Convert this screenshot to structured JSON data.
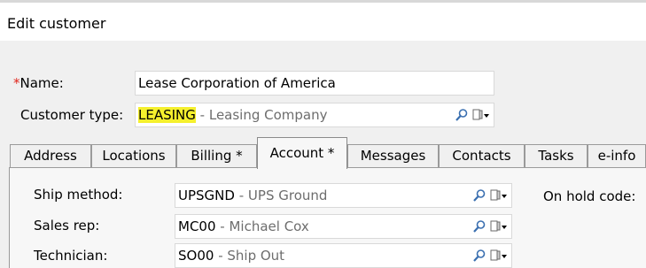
{
  "window": {
    "title": "Edit customer"
  },
  "form": {
    "name_required_mark": "*",
    "name_label": "Name:",
    "name_value": "Lease Corporation of America",
    "customer_type_label": "Customer type:",
    "customer_type_code": "LEASING",
    "customer_type_desc": "- Leasing Company"
  },
  "tabs": [
    {
      "label": "Address"
    },
    {
      "label": "Locations"
    },
    {
      "label": "Billing *"
    },
    {
      "label": "Account *"
    },
    {
      "label": "Messages"
    },
    {
      "label": "Contacts"
    },
    {
      "label": "Tasks"
    },
    {
      "label": "e-info"
    }
  ],
  "active_tab": "Account *",
  "account": {
    "ship_method_label": "Ship method:",
    "ship_method_code": "UPSGND",
    "ship_method_desc": "- UPS Ground",
    "sales_rep_label": "Sales rep:",
    "sales_rep_code": "MC00",
    "sales_rep_desc": "- Michael Cox",
    "technician_label": "Technician:",
    "technician_code": "SO00",
    "technician_desc": "- Ship Out",
    "on_hold_label": "On hold code:"
  },
  "icons": {
    "lookup": "magnifier-icon",
    "menu": "document-dropdown-icon"
  },
  "colors": {
    "required": "#e0241b",
    "highlight": "#f5f02d",
    "desc_text": "#6d6d6d"
  }
}
